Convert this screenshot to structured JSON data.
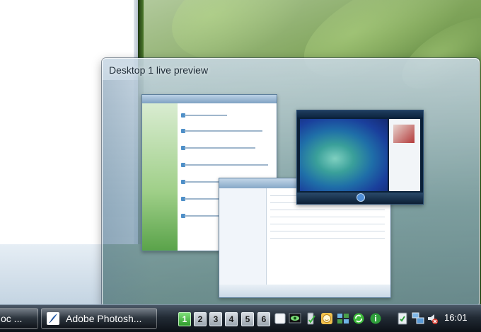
{
  "preview": {
    "title": "Desktop 1 live preview"
  },
  "taskbar": {
    "buttons": [
      {
        "label": "oc ...",
        "icon": "word-document-icon"
      },
      {
        "label": "Adobe Photosh...",
        "icon": "photoshop-feather-icon"
      }
    ],
    "desktops": [
      "1",
      "2",
      "3",
      "4",
      "5",
      "6"
    ],
    "active_desktop": "1",
    "tray_icons": [
      "white-window-icon",
      "eye-monitor-icon",
      "battery-check-icon",
      "smiley-clock-icon",
      "network-grid-icon",
      "green-sync-icon",
      "green-info-icon",
      "shield-check-icon",
      "network-computers-icon",
      "volume-muted-icon"
    ],
    "clock": "16:01"
  },
  "colors": {
    "active_desktop": "#2e9a2a",
    "taskbar_dark": "#0c1117"
  }
}
